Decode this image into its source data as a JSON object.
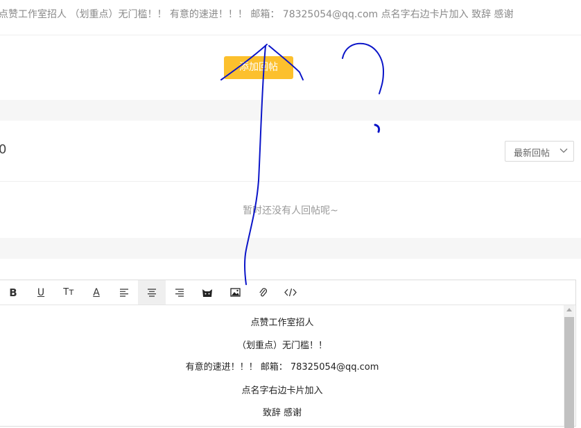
{
  "post": {
    "text": "点赞工作室招人 （划重点）无门槛！！ 有意的速进！！！ 邮箱： 78325054@qq.com 点名字右边卡片加入 致辞 感谢"
  },
  "actions": {
    "add_reply_label": "添加回帖"
  },
  "replies": {
    "count": "0",
    "sort_selected": "最新回帖",
    "empty_message": "暂时还没有人回帖呢~"
  },
  "editor": {
    "toolbar_icons": [
      "bold-icon",
      "underline-icon",
      "text-size-icon",
      "font-color-icon",
      "align-left-icon",
      "align-center-icon",
      "align-right-icon",
      "emoji-icon",
      "image-icon",
      "attachment-icon",
      "code-icon"
    ],
    "toolbar_text": {
      "bold": "B",
      "underline": "U",
      "text_size": "Tт",
      "font_color": "A"
    },
    "lines": [
      "点赞工作室招人",
      "（划重点）无门槛！！",
      "有意的速进！！！  邮箱：  78325054@qq.com",
      "点名字右边卡片加入",
      "致辞 感谢"
    ]
  },
  "colors": {
    "button": "#fcc02d",
    "ink": "#0a14c8"
  }
}
